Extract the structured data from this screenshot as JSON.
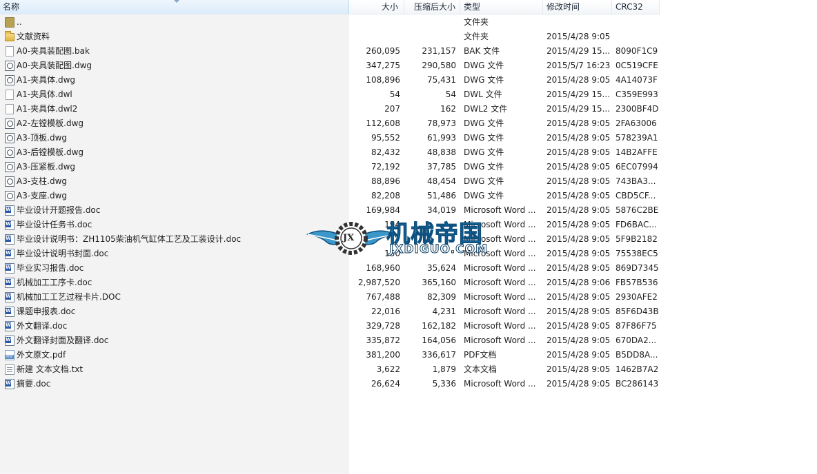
{
  "columns": {
    "name": "名称",
    "size": "大小",
    "packed": "压缩后大小",
    "type": "类型",
    "modified": "修改时间",
    "crc": "CRC32"
  },
  "files": [
    {
      "icon": "parent-folder-icon",
      "name": "..",
      "size": "",
      "packed": "",
      "type": "文件夹",
      "modified": "",
      "crc": ""
    },
    {
      "icon": "folder-icon",
      "name": "文献资料",
      "size": "",
      "packed": "",
      "type": "文件夹",
      "modified": "2015/4/28 9:05",
      "crc": ""
    },
    {
      "icon": "file-icon",
      "name": "A0-夹具装配图.bak",
      "size": "260,095",
      "packed": "231,157",
      "type": "BAK 文件",
      "modified": "2015/4/29 15...",
      "crc": "8090F1C9"
    },
    {
      "icon": "dwg-icon",
      "name": "A0-夹具装配图.dwg",
      "size": "347,275",
      "packed": "290,580",
      "type": "DWG 文件",
      "modified": "2015/5/7 16:23",
      "crc": "0C519CFE"
    },
    {
      "icon": "dwg-icon",
      "name": "A1-夹具体.dwg",
      "size": "108,896",
      "packed": "75,431",
      "type": "DWG 文件",
      "modified": "2015/4/28 9:05",
      "crc": "4A14073F"
    },
    {
      "icon": "file-icon",
      "name": "A1-夹具体.dwl",
      "size": "54",
      "packed": "54",
      "type": "DWL 文件",
      "modified": "2015/4/29 15...",
      "crc": "C359E993"
    },
    {
      "icon": "file-icon",
      "name": "A1-夹具体.dwl2",
      "size": "207",
      "packed": "162",
      "type": "DWL2 文件",
      "modified": "2015/4/29 15...",
      "crc": "2300BF4D"
    },
    {
      "icon": "dwg-icon",
      "name": "A2-左镗模板.dwg",
      "size": "112,608",
      "packed": "78,973",
      "type": "DWG 文件",
      "modified": "2015/4/28 9:05",
      "crc": "2FA63006"
    },
    {
      "icon": "dwg-icon",
      "name": "A3-顶板.dwg",
      "size": "95,552",
      "packed": "61,993",
      "type": "DWG 文件",
      "modified": "2015/4/28 9:05",
      "crc": "578239A1"
    },
    {
      "icon": "dwg-icon",
      "name": "A3-后镗模板.dwg",
      "size": "82,432",
      "packed": "48,838",
      "type": "DWG 文件",
      "modified": "2015/4/28 9:05",
      "crc": "14B2AFFE"
    },
    {
      "icon": "dwg-icon",
      "name": "A3-压紧板.dwg",
      "size": "72,192",
      "packed": "37,785",
      "type": "DWG 文件",
      "modified": "2015/4/28 9:05",
      "crc": "6EC07994"
    },
    {
      "icon": "dwg-icon",
      "name": "A3-支柱.dwg",
      "size": "88,896",
      "packed": "48,454",
      "type": "DWG 文件",
      "modified": "2015/4/28 9:05",
      "crc": "743BA3..."
    },
    {
      "icon": "dwg-icon",
      "name": "A3-支座.dwg",
      "size": "82,208",
      "packed": "51,486",
      "type": "DWG 文件",
      "modified": "2015/4/28 9:05",
      "crc": "CBD5CF..."
    },
    {
      "icon": "doc-icon",
      "name": "毕业设计开题报告.doc",
      "size": "169,984",
      "packed": "34,019",
      "type": "Microsoft Word ...",
      "modified": "2015/4/28 9:05",
      "crc": "5876C2BE"
    },
    {
      "icon": "doc-icon",
      "name": "毕业设计任务书.doc",
      "size": "194",
      "packed": "",
      "type": "Microsoft Word ...",
      "modified": "2015/4/28 9:05",
      "crc": "FD6BAC..."
    },
    {
      "icon": "doc-icon",
      "name": "毕业设计说明书：ZH1105柴油机气缸体工艺及工装设计.doc",
      "size": "",
      "packed": "",
      "type": "Microsoft Word ...",
      "modified": "2015/4/28 9:05",
      "crc": "5F9B2182"
    },
    {
      "icon": "doc-icon",
      "name": "毕业设计说明书封面.doc",
      "size": "150",
      "packed": "",
      "type": "Microsoft Word ...",
      "modified": "2015/4/28 9:05",
      "crc": "75538EC5"
    },
    {
      "icon": "doc-icon",
      "name": "毕业实习报告.doc",
      "size": "168,960",
      "packed": "35,624",
      "type": "Microsoft Word ...",
      "modified": "2015/4/28 9:05",
      "crc": "869D7345"
    },
    {
      "icon": "doc-icon",
      "name": "机械加工工序卡.doc",
      "size": "2,987,520",
      "packed": "365,160",
      "type": "Microsoft Word ...",
      "modified": "2015/4/28 9:06",
      "crc": "FB57B536"
    },
    {
      "icon": "doc-icon",
      "name": "机械加工工艺过程卡片.DOC",
      "size": "767,488",
      "packed": "82,309",
      "type": "Microsoft Word ...",
      "modified": "2015/4/28 9:05",
      "crc": "2930AFE2"
    },
    {
      "icon": "doc-icon",
      "name": "课题申报表.doc",
      "size": "22,016",
      "packed": "4,231",
      "type": "Microsoft Word ...",
      "modified": "2015/4/28 9:05",
      "crc": "85F6D43B"
    },
    {
      "icon": "doc-icon",
      "name": "外文翻译.doc",
      "size": "329,728",
      "packed": "162,182",
      "type": "Microsoft Word ...",
      "modified": "2015/4/28 9:05",
      "crc": "87F86F75"
    },
    {
      "icon": "doc-icon",
      "name": "外文翻译封面及翻译.doc",
      "size": "335,872",
      "packed": "164,056",
      "type": "Microsoft Word ...",
      "modified": "2015/4/28 9:05",
      "crc": "670DA2..."
    },
    {
      "icon": "pdf-icon",
      "name": "外文原文.pdf",
      "size": "381,200",
      "packed": "336,617",
      "type": "PDF文档",
      "modified": "2015/4/28 9:05",
      "crc": "B5DD8A..."
    },
    {
      "icon": "txt-icon",
      "name": "新建 文本文档.txt",
      "size": "3,622",
      "packed": "1,879",
      "type": "文本文档",
      "modified": "2015/4/28 9:05",
      "crc": "1462B7A2"
    },
    {
      "icon": "doc-icon",
      "name": "摘要.doc",
      "size": "26,624",
      "packed": "5,336",
      "type": "Microsoft Word ...",
      "modified": "2015/4/28 9:05",
      "crc": "BC286143"
    }
  ],
  "watermark": {
    "title": "机械帝国",
    "url": "JXDIGUO.COM",
    "badge": "JX"
  }
}
